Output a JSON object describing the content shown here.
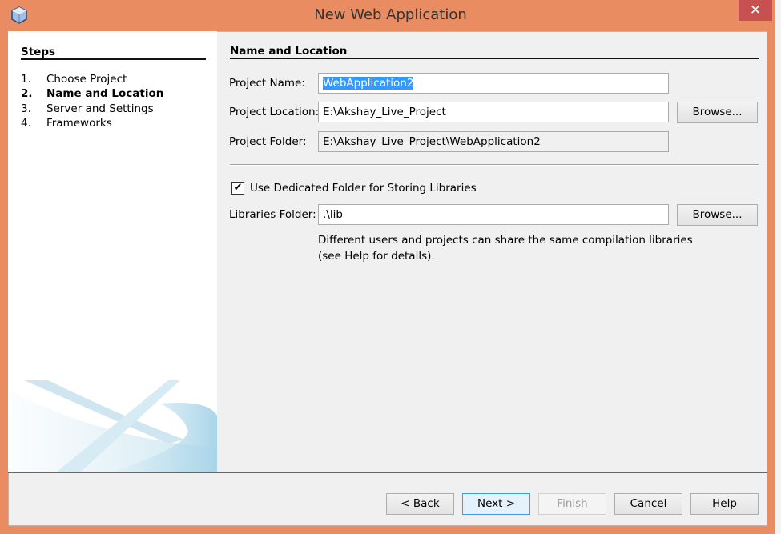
{
  "window": {
    "title": "New Web Application",
    "close_glyph": "✕"
  },
  "steps": {
    "heading": "Steps",
    "items": [
      {
        "num": "1.",
        "label": "Choose Project"
      },
      {
        "num": "2.",
        "label": "Name and Location"
      },
      {
        "num": "3.",
        "label": "Server and Settings"
      },
      {
        "num": "4.",
        "label": "Frameworks"
      }
    ],
    "current_index": 1
  },
  "panel": {
    "heading": "Name and Location",
    "project_name_label": "Project Name:",
    "project_name_value": "WebApplication2",
    "project_location_label": "Project Location:",
    "project_location_value": "E:\\Akshay_Live_Project",
    "project_folder_label": "Project Folder:",
    "project_folder_value": "E:\\Akshay_Live_Project\\WebApplication2",
    "browse_label": "Browse...",
    "dedicated_folder_label": "Use Dedicated Folder for Storing Libraries",
    "dedicated_folder_checked": true,
    "libraries_folder_label": "Libraries Folder:",
    "libraries_folder_value": ".\\lib",
    "help_line1": "Different users and projects can share the same compilation libraries",
    "help_line2": "(see Help for details)."
  },
  "buttons": {
    "back": "< Back",
    "next": "Next >",
    "finish": "Finish",
    "cancel": "Cancel",
    "help": "Help"
  }
}
